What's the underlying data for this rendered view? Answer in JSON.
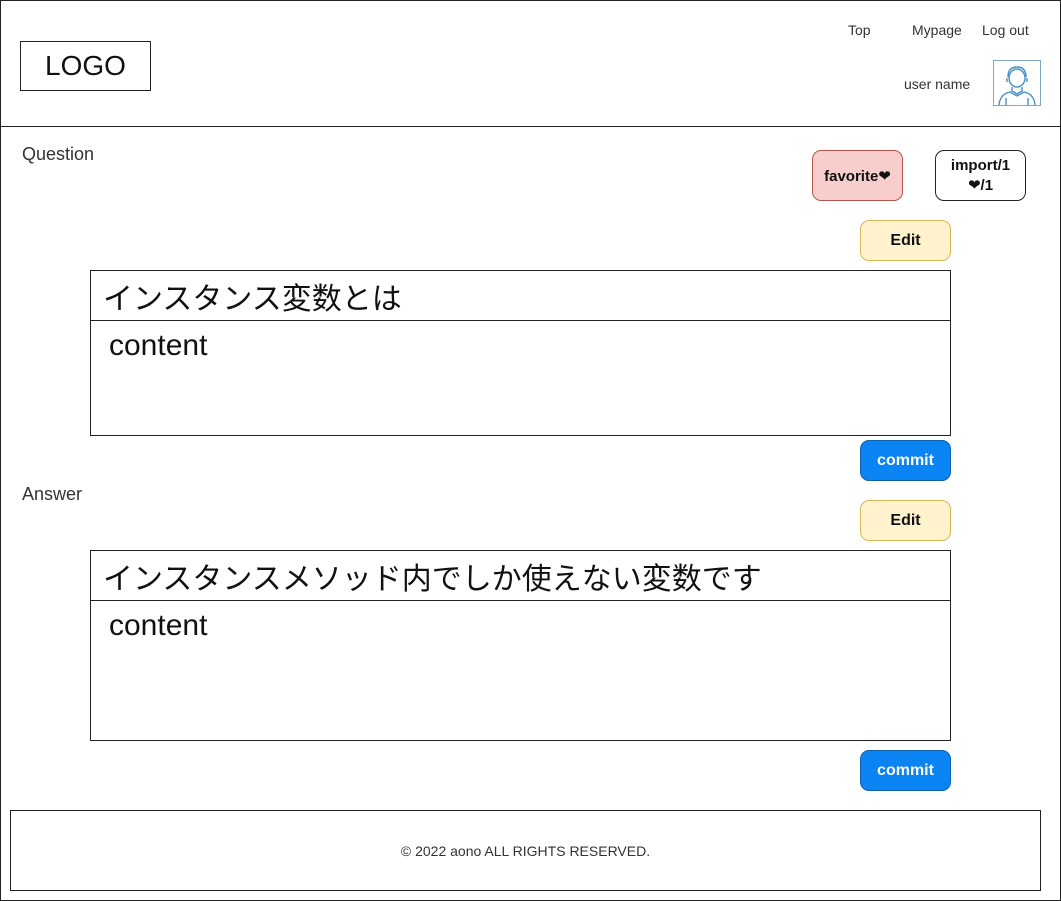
{
  "header": {
    "logo_text": "LOGO",
    "nav": {
      "top": "Top",
      "mypage": "Mypage",
      "logout": "Log out"
    },
    "user_name": "user name",
    "avatar_icon": "user-avatar-icon"
  },
  "question": {
    "section_label": "Question",
    "favorite_label": "favorite❤",
    "import_line1": "import/1",
    "import_line2": "❤/1",
    "edit_label": "Edit",
    "title": "インスタンス変数とは",
    "content": "content",
    "commit_label": "commit"
  },
  "answer": {
    "section_label": "Answer",
    "edit_label": "Edit",
    "title": "インスタンスメソッド内でしか使えない変数です",
    "content": "content",
    "commit_label": "commit"
  },
  "footer": {
    "copyright": "© 2022 aono ALL RIGHTS RESERVED."
  },
  "colors": {
    "favorite_bg": "#f8cecc",
    "edit_bg": "#fff2cc",
    "commit_bg": "#0a84f2"
  }
}
